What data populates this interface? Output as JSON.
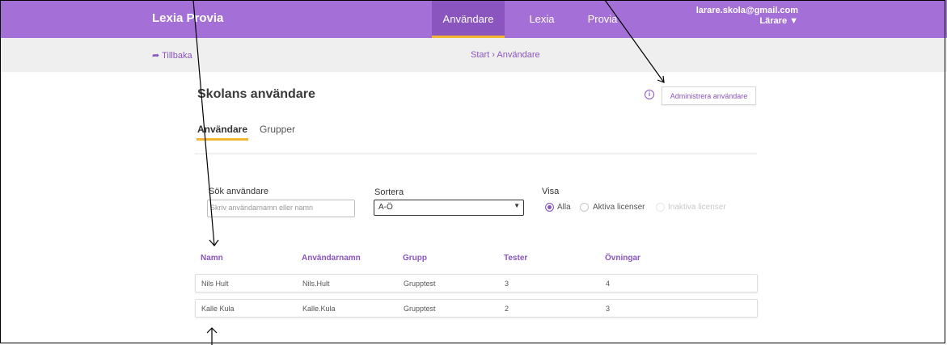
{
  "header": {
    "brand": "Lexia Provia",
    "nav": [
      "Användare",
      "Lexia",
      "Provia"
    ],
    "user_email": "larare.skola@gmail.com",
    "user_role": "Lärare ▼"
  },
  "subheader": {
    "back": "Tillbaka",
    "breadcrumb": "Start › Användare"
  },
  "page": {
    "title": "Skolans användare",
    "admin_button": "Administrera användare",
    "info_icon": "ⓘ",
    "tabs": [
      "Användare",
      "Grupper"
    ]
  },
  "filters": {
    "search_label": "Sök användare",
    "search_placeholder": "Skriv användarnamn eller namn",
    "sort_label": "Sortera",
    "sort_value": "A-Ö",
    "show_label": "Visa",
    "show_options": [
      "Alla",
      "Aktiva licenser",
      "Inaktiva licenser"
    ],
    "show_selected": "Alla"
  },
  "table": {
    "columns": [
      "Namn",
      "Användarnamn",
      "Grupp",
      "Tester",
      "Övningar"
    ],
    "rows": [
      [
        "Nils Hult",
        "Nils.Hult",
        "Grupptest",
        "3",
        "4"
      ],
      [
        "Kalle Kula",
        "Kalle.Kula",
        "Grupptest",
        "2",
        "3"
      ]
    ]
  },
  "colors": {
    "accent": "#a56fd8",
    "accent_dark": "#8a55be",
    "highlight": "#f2b632"
  }
}
